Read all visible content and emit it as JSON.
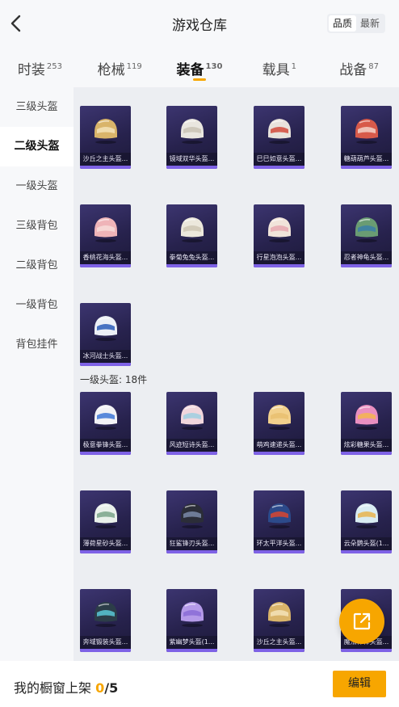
{
  "header": {
    "title": "游戏仓库",
    "sort_options": [
      "品质",
      "最新"
    ],
    "active_sort": 0
  },
  "tabs": [
    {
      "label": "时装",
      "count": "253"
    },
    {
      "label": "枪械",
      "count": "119"
    },
    {
      "label": "装备",
      "count": "130"
    },
    {
      "label": "载具",
      "count": "1"
    },
    {
      "label": "战备",
      "count": "87"
    }
  ],
  "active_tab": 2,
  "sidebar": {
    "items": [
      "三级头盔",
      "二级头盔",
      "一级头盔",
      "三级背包",
      "二级背包",
      "一级背包",
      "背包挂件"
    ],
    "active_index": 1
  },
  "sections": [
    {
      "label": "",
      "items": [
        {
          "name": "沙丘之主头盔...",
          "helmet_color": "#d9b46a",
          "accent": "#f3e3b8"
        },
        {
          "name": "镜域双华头盔...",
          "helmet_color": "#e9e6df",
          "accent": "#c9c2b5"
        },
        {
          "name": "巳巳如意头盔...",
          "helmet_color": "#e8e2dc",
          "accent": "#d24a3c"
        },
        {
          "name": "糖葫葫芦头盔...",
          "helmet_color": "#d75a4a",
          "accent": "#f3d2c8"
        },
        {
          "name": "香桃花海头盔...",
          "helmet_color": "#efb4b8",
          "accent": "#f7dcd8"
        },
        {
          "name": "拳菊兔兔头盔...",
          "helmet_color": "#ece8dc",
          "accent": "#cfc7b4"
        },
        {
          "name": "行星泡泡头盔...",
          "helmet_color": "#f1e4da",
          "accent": "#e7a9b0"
        },
        {
          "name": "忍者神龟头盔...",
          "helmet_color": "#6a9c73",
          "accent": "#3a7fa8"
        },
        {
          "name": "冰河战士头盔...",
          "helmet_color": "#ecf0f6",
          "accent": "#2c5db8"
        }
      ]
    },
    {
      "label": "一级头盔: 18件",
      "items": [
        {
          "name": "极意拳锋头盔...",
          "helmet_color": "#f2f2f5",
          "accent": "#3f78d6"
        },
        {
          "name": "风迹短诗头盔...",
          "helmet_color": "#f1d6dc",
          "accent": "#9fcfe0"
        },
        {
          "name": "萌鸡速递头盔...",
          "helmet_color": "#f2d08c",
          "accent": "#e9c070"
        },
        {
          "name": "炫彩糖果头盔...",
          "helmet_color": "#e98fc0",
          "accent": "#f4b64d"
        },
        {
          "name": "薄荷星砂头盔...",
          "helmet_color": "#e9f0ea",
          "accent": "#7aa489"
        },
        {
          "name": "狂鲨锋刃头盔...",
          "helmet_color": "#2b2d38",
          "accent": "#7a8aa8"
        },
        {
          "name": "环太平洋头盔...",
          "helmet_color": "#2c4a8a",
          "accent": "#d8452f"
        },
        {
          "name": "云朵鹦头盔(1...",
          "helmet_color": "#d9ecf2",
          "accent": "#e8b44d"
        },
        {
          "name": "奔域锻装头盔...",
          "helmet_color": "#2c3d48",
          "accent": "#59c7d6"
        },
        {
          "name": "紫幽梦头盔(1...",
          "helmet_color": "#b49ae8",
          "accent": "#8a6cd6"
        },
        {
          "name": "沙丘之主头盔...",
          "helmet_color": "#d9b46a",
          "accent": "#f3e3b8"
        },
        {
          "name": "魔法棒棒头盔...",
          "helmet_color": "#f0c24c",
          "accent": "#e89a2c"
        }
      ]
    }
  ],
  "footer": {
    "shelf_label": "我的橱窗上架",
    "shelf_count": "0",
    "shelf_total": "/5",
    "edit_label": "编辑"
  },
  "icons": {
    "back": "chevron-left-icon",
    "share": "external-link-icon"
  },
  "colors": {
    "accent": "#f7a600",
    "card_bg": "#27224d",
    "rarity_bar": "#7e62e6"
  }
}
